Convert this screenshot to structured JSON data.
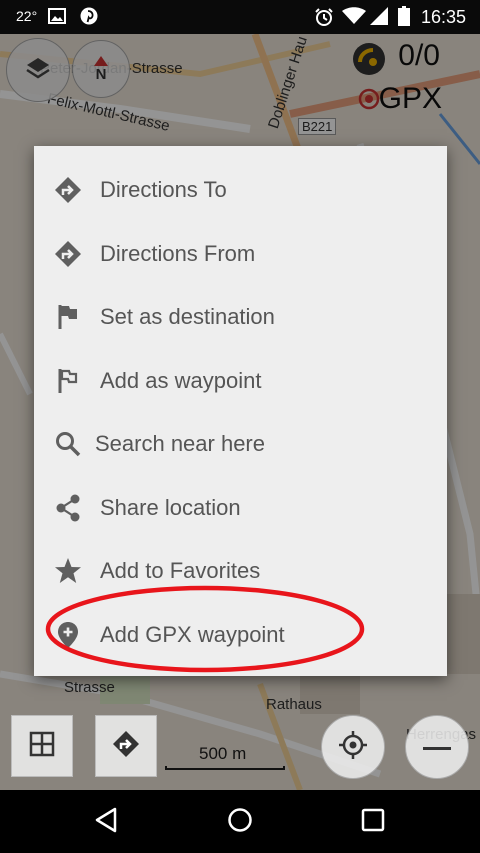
{
  "status_bar": {
    "temperature": "22°",
    "time": "16:35",
    "icons": [
      "image-icon",
      "pinterest-icon",
      "alarm-icon",
      "wifi-icon",
      "signal-icon",
      "battery-icon"
    ]
  },
  "map": {
    "streets": {
      "peter_jordan": "Peter-Jordan-Strasse",
      "felix_mottl": "Felix-Mottl-Strasse",
      "doblinger": "Doblinger Hau",
      "b221": "B221",
      "strasse": "Strasse",
      "rathaus": "Rathaus",
      "herrengasse": "Herrengas"
    },
    "gpx_counter": "0/0",
    "gpx_label": "GPX",
    "scale_label": "500 m",
    "compass_letter": "N"
  },
  "context_menu": {
    "items": [
      {
        "label": "Directions To",
        "icon": "directions-icon"
      },
      {
        "label": "Directions From",
        "icon": "directions-icon"
      },
      {
        "label": "Set as destination",
        "icon": "flag-filled-icon"
      },
      {
        "label": "Add as waypoint",
        "icon": "flag-outline-icon"
      },
      {
        "label": "Search near here",
        "icon": "search-icon"
      },
      {
        "label": "Share location",
        "icon": "share-icon"
      },
      {
        "label": "Add to Favorites",
        "icon": "star-icon"
      },
      {
        "label": "Add GPX waypoint",
        "icon": "location-add-icon"
      }
    ]
  },
  "colors": {
    "menu_background": "#eeeeee",
    "menu_text": "#555555",
    "highlight": "#e8151b",
    "icon": "#5f5f5f"
  }
}
